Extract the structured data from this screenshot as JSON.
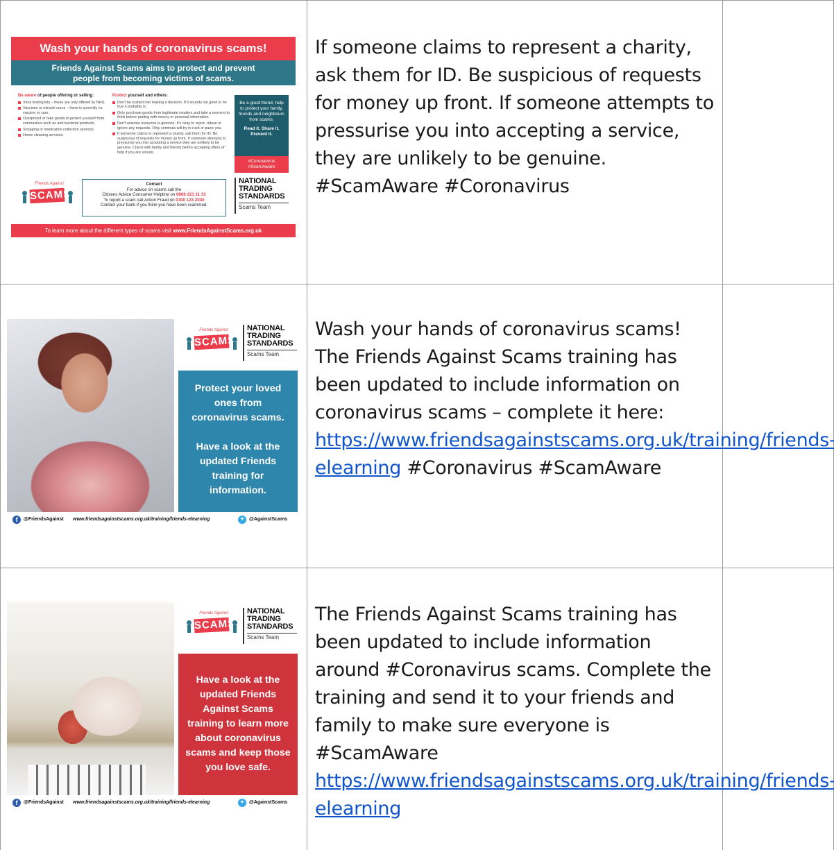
{
  "rows": [
    {
      "poster": {
        "title": "Wash your hands of coronavirus scams!",
        "subtitle_line1": "Friends Against Scams aims to protect and prevent",
        "subtitle_line2": "people from becoming victims of scams.",
        "left_heading_pre": "Be ",
        "left_heading_hl": "aware",
        "left_heading_post": " of people offering or selling:",
        "left_items": [
          "Virus testing kits – these are only offered by NHS.",
          "Vaccines or miracle cures – there is currently no vaccine or cure.",
          "Overpriced or fake goods to protect yourself from coronavirus such as anti-bacterial products.",
          "Shopping or medication collection services.",
          "Home cleaning services."
        ],
        "mid_heading_hl": "Protect",
        "mid_heading_post": " yourself and others:",
        "mid_items": [
          "Don't be rushed into making a decision. If it sounds too good to be true it probably is.",
          "Only purchase goods from legitimate retailers and take a moment to think before parting with money or personal information.",
          "Don't assume everyone is genuine. It's okay to reject, refuse or ignore any requests. Only criminals will try to rush or panic you.",
          "If someone claims to represent a charity, ask them for ID. Be suspicious of requests for money up front. If someone attempts to pressurise you into accepting a service they are unlikely to be genuine. Check with family and friends before accepting offers of help if you are unsure."
        ],
        "side_text": "Be a good friend, help to protect your family, friends and neighbours from scams.",
        "side_bold": "Read it. Share it. Prevent it.",
        "side_tags": "#Coronavirus #ScamAware",
        "contact_title": "Contact",
        "contact_line1": "For advice on scams call the",
        "contact_line2_pre": "Citizens Advice Consumer Helpline on ",
        "contact_line2_num": "0808 223 11 33",
        "contact_line3_pre": "To report a scam call Action Fraud on ",
        "contact_line3_num": "0300 123 2040",
        "contact_line4": "Contact your bank if you think you have been scammed.",
        "footer_pre": "To learn more about the different types of scams visit ",
        "footer_url": "www.FriendsAgainstScams.org.uk"
      },
      "text": "If someone claims to represent a charity, ask them for ID. Be suspicious of requests for money up front. If someone attempts to pressurise you into accepting a service, they are unlikely to be genuine. #ScamAware #Coronavirus"
    },
    {
      "poster": {
        "panel_text_1": "Protect your loved ones from coronavirus scams.",
        "panel_text_2": "Have a look at the updated Friends training for information."
      },
      "text_before": "Wash your hands of coronavirus scams! The Friends Against Scams training has been updated to include information on coronavirus scams – complete it here: ",
      "link": "https://www.friendsagainstscams.org.uk/training/friends-elearning",
      "text_after": " #Coronavirus #ScamAware"
    },
    {
      "poster": {
        "panel_text": "Have a look at the updated Friends Against Scams training to learn more about coronavirus scams and keep those you love safe."
      },
      "text_before": "The Friends Against Scams training has been updated to include information around #Coronavirus scams. Complete the training and send it to your friends and family to make sure everyone is #ScamAware ",
      "link": "https://www.friendsagainstscams.org.uk/training/friends-elearning"
    }
  ],
  "logos": {
    "fas_arch": "Friends Against",
    "fas_sign": "SCAMS",
    "nts_line1": "NATIONAL",
    "nts_line2": "TRADING",
    "nts_line3": "STANDARDS",
    "nts_sub": "Scams Team"
  },
  "social": {
    "facebook": "@FriendsAgainst",
    "url": "www.friendsagainstscams.org.uk/training/friends-elearning",
    "twitter": "@AgainstScams"
  },
  "colors": {
    "brand_red": "#ea3c4a",
    "brand_teal": "#2d7789",
    "panel_blue": "#2f86ad",
    "panel_red": "#cf343d",
    "link": "#1155cc"
  }
}
